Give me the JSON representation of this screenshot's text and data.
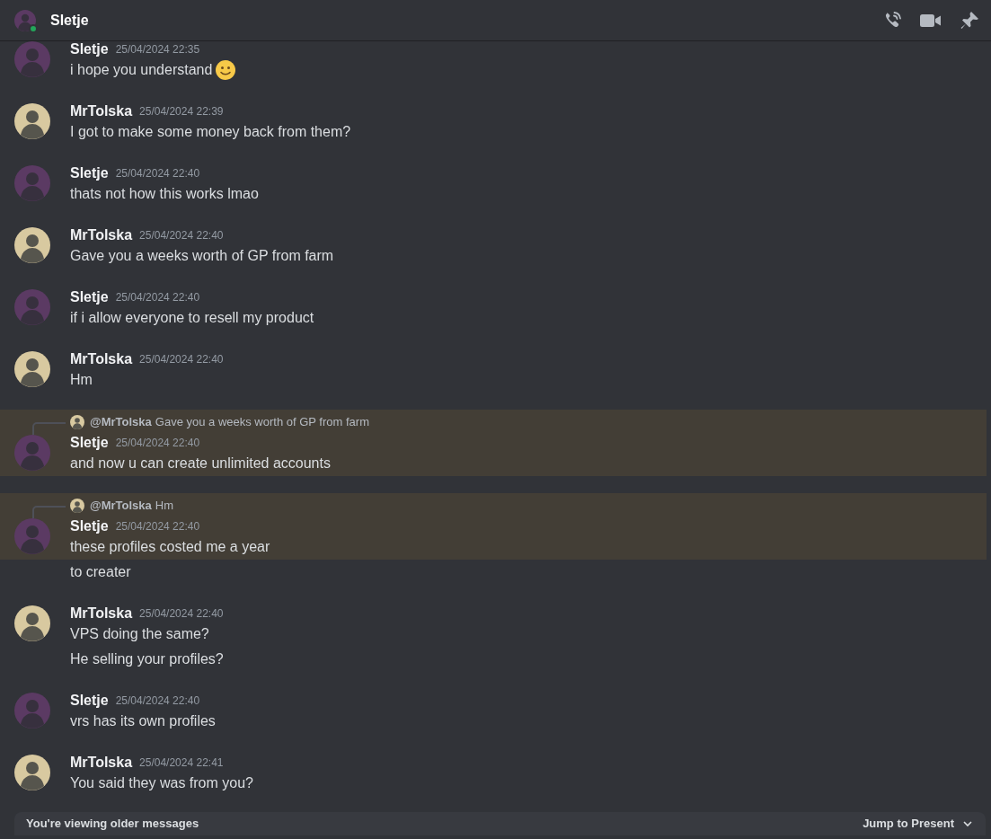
{
  "header": {
    "title": "Sletje",
    "online": true
  },
  "messages": [
    {
      "author": "Sletje",
      "time": "25/04/2024 22:35",
      "color": "#5b3a63",
      "highlighted": false,
      "lines": [
        {
          "text": "i hope you understand",
          "emoji": true
        }
      ]
    },
    {
      "author": "MrTolska",
      "time": "25/04/2024 22:39",
      "color": "#d8c9a0",
      "highlighted": false,
      "lines": [
        {
          "text": "I got to make some money back from them?"
        }
      ]
    },
    {
      "author": "Sletje",
      "time": "25/04/2024 22:40",
      "color": "#5b3a63",
      "highlighted": false,
      "lines": [
        {
          "text": "thats not how this works lmao"
        }
      ]
    },
    {
      "author": "MrTolska",
      "time": "25/04/2024 22:40",
      "color": "#d8c9a0",
      "highlighted": false,
      "lines": [
        {
          "text": "Gave you a weeks worth of GP from farm"
        }
      ]
    },
    {
      "author": "Sletje",
      "time": "25/04/2024 22:40",
      "color": "#5b3a63",
      "highlighted": false,
      "lines": [
        {
          "text": "if i allow everyone to resell my product"
        }
      ]
    },
    {
      "author": "MrTolska",
      "time": "25/04/2024 22:40",
      "color": "#d8c9a0",
      "highlighted": false,
      "lines": [
        {
          "text": "Hm"
        }
      ]
    },
    {
      "author": "Sletje",
      "time": "25/04/2024 22:40",
      "color": "#5b3a63",
      "highlighted": true,
      "reply": {
        "mention": "@MrTolska",
        "text": "Gave you a weeks worth of GP from farm"
      },
      "lines": [
        {
          "text": "and now u can create unlimited accounts"
        }
      ]
    },
    {
      "author": "Sletje",
      "time": "25/04/2024 22:40",
      "color": "#5b3a63",
      "highlighted": true,
      "reply": {
        "mention": "@MrTolska",
        "text": "Hm"
      },
      "lines": [
        {
          "text": "these profiles costed me a year"
        }
      ],
      "followups": [
        "to creater"
      ]
    },
    {
      "author": "MrTolska",
      "time": "25/04/2024 22:40",
      "color": "#d8c9a0",
      "highlighted": false,
      "lines": [
        {
          "text": "VPS doing the same?"
        }
      ],
      "followups": [
        "He selling your profiles?"
      ]
    },
    {
      "author": "Sletje",
      "time": "25/04/2024 22:40",
      "color": "#5b3a63",
      "highlighted": false,
      "lines": [
        {
          "text": "vrs has its own profiles"
        }
      ]
    },
    {
      "author": "MrTolska",
      "time": "25/04/2024 22:41",
      "color": "#d8c9a0",
      "highlighted": false,
      "lines": [
        {
          "text": "You said they was from you?"
        }
      ]
    }
  ],
  "banner": {
    "text": "You're viewing older messages",
    "action": "Jump to Present"
  }
}
